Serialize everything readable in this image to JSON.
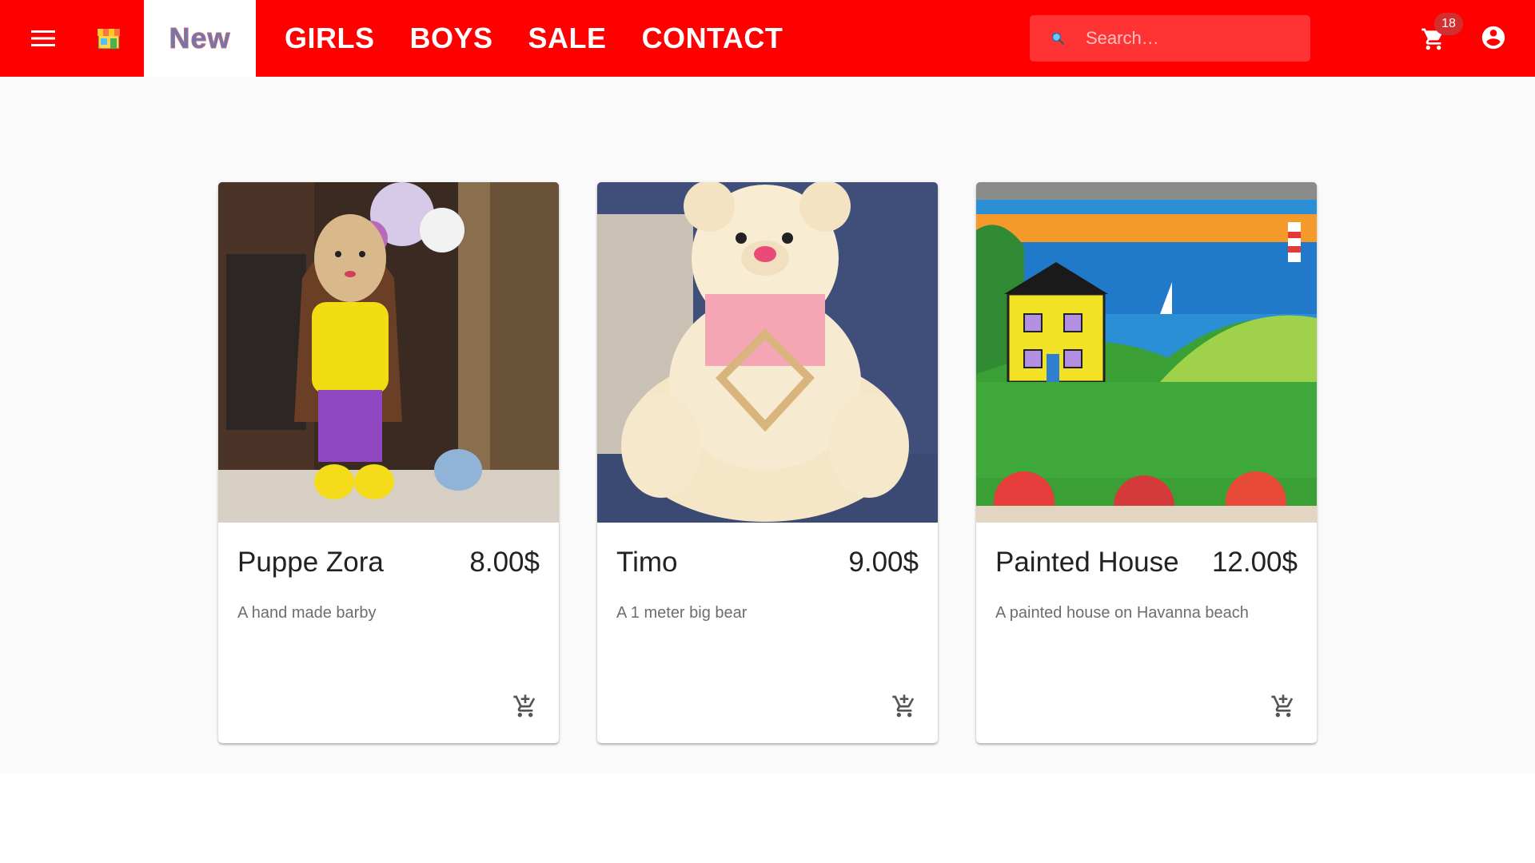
{
  "header": {
    "brand_tab": "New",
    "nav": [
      "GIRLS",
      "BOYS",
      "SALE",
      "CONTACT"
    ],
    "search_placeholder": "Search…",
    "cart_count": "18",
    "accent": "#ff0000"
  },
  "icons": {
    "menu": "menu-icon",
    "store": "store-icon",
    "search": "search-icon",
    "cart": "cart-icon",
    "account": "account-circle-icon",
    "add_cart": "add-shopping-cart-icon"
  },
  "products": [
    {
      "title": "Puppe Zora",
      "price": "8.00$",
      "description": "A hand made barby"
    },
    {
      "title": "Timo",
      "price": "9.00$",
      "description": "A 1 meter big bear"
    },
    {
      "title": "Painted House",
      "price": "12.00$",
      "description": "A painted house on Havanna beach"
    }
  ]
}
